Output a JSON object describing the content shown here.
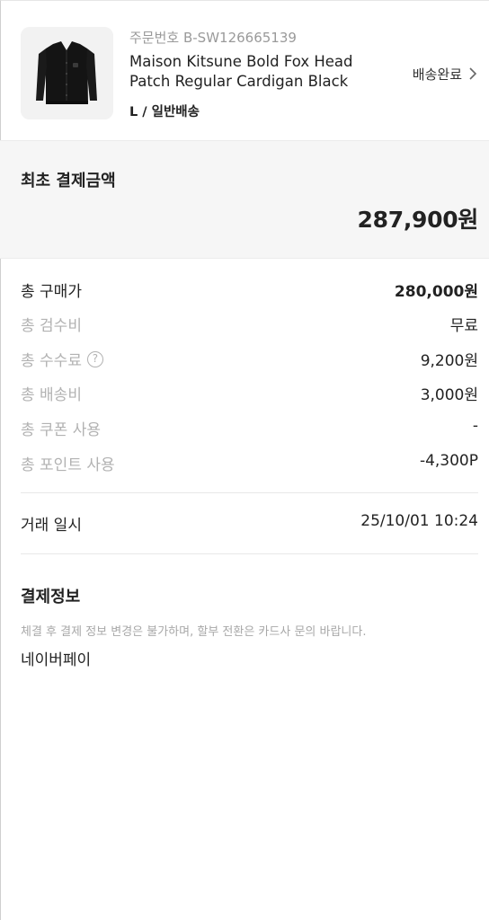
{
  "order": {
    "order_number": "주문번호 B-SW126665139",
    "product_name": "Maison Kitsune Bold Fox Head Patch Regular Cardigan Black",
    "option": "L / 일반배송",
    "status": "배송완료",
    "thumbnail_icon": "black-cardigan-image",
    "chevron_icon": "chevron-right-icon"
  },
  "initial_payment": {
    "label": "최초 결제금액",
    "amount": "287,900원"
  },
  "breakdown": [
    {
      "label": "총 구매가",
      "value": "280,000원"
    },
    {
      "label": "총 검수비",
      "value": "무료"
    },
    {
      "label": "총 수수료",
      "value": "9,200원",
      "help": "?"
    },
    {
      "label": "총 배송비",
      "value": "3,000원"
    },
    {
      "label": "총 쿠폰 사용",
      "value": "-"
    },
    {
      "label": "총 포인트 사용",
      "value": "-4,300P"
    }
  ],
  "trade": {
    "label": "거래 일시",
    "value": "25/10/01 10:24"
  },
  "payment_info": {
    "title": "결제정보",
    "notice": "체결 후 결제 정보 변경은 불가하며, 할부 전환은 카드사 문의 바랍니다.",
    "method": "네이버페이"
  },
  "colors": {
    "primary_text": "#222222",
    "muted_text": "#b2b2b2",
    "section_bg": "#f6f6f6"
  }
}
